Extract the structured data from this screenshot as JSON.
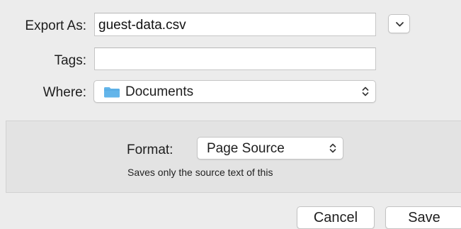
{
  "export": {
    "label": "Export As:",
    "filename": "guest-data.csv",
    "expand_icon": "chevron-down-icon"
  },
  "tags": {
    "label": "Tags:",
    "value": ""
  },
  "where": {
    "label": "Where:",
    "folder_icon": "folder-icon",
    "value": "Documents"
  },
  "format": {
    "label": "Format:",
    "value": "Page Source",
    "description": "Saves only the source text of this"
  },
  "buttons": {
    "cancel": "Cancel",
    "save": "Save"
  },
  "colors": {
    "folder": "#63b5ea",
    "window_background": "#ececec",
    "panel_background": "#e3e3e3"
  }
}
